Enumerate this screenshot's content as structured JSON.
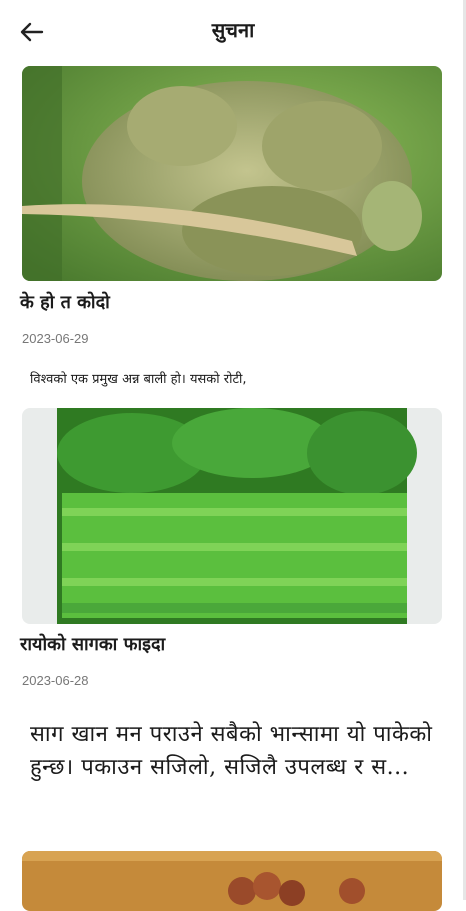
{
  "header": {
    "title": "सुचना",
    "back_icon": "arrow-left-icon"
  },
  "articles": [
    {
      "title": "के हो त कोदो",
      "date": "2023-06-29",
      "summary": "विश्वको एक प्रमुख अन्न बाली हो। यसको रोटी,"
    },
    {
      "title": "रायोको सागका फाइदा",
      "date": "2023-06-28",
      "summary": "साग खान मन पराउने सबैको भान्सामा यो पाकेको हुन्छ। पकाउन सजिलो, सजिलै उपलब्ध र स..."
    }
  ],
  "colors": {
    "background": "#ffffff",
    "date": "#777777",
    "millet": "#9aa56a",
    "greens": "#3f9b2f",
    "grain": "#c58a3a"
  }
}
